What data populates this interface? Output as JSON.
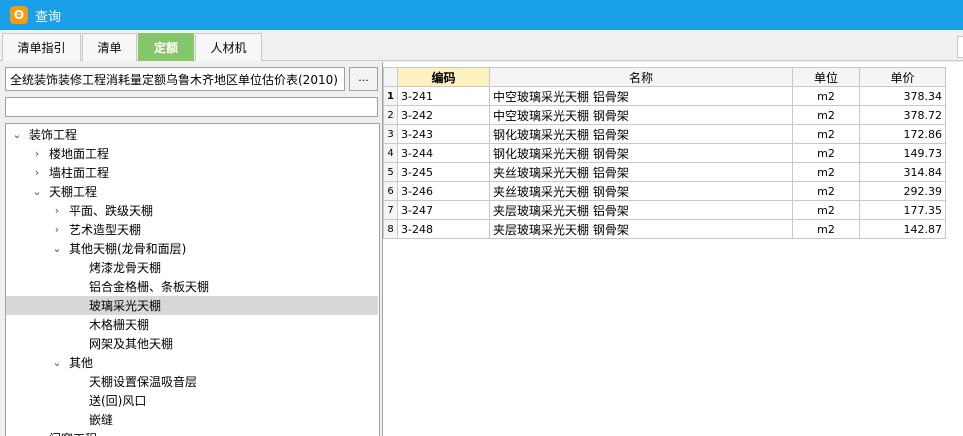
{
  "window": {
    "title": "查询"
  },
  "tabs": [
    {
      "label": "清单指引",
      "active": false
    },
    {
      "label": "清单",
      "active": false
    },
    {
      "label": "定额",
      "active": true
    },
    {
      "label": "人材机",
      "active": false
    }
  ],
  "left": {
    "library": "全统装饰装修工程消耗量定额乌鲁木齐地区单位估价表(2010)",
    "dots_label": "...",
    "search_value": ""
  },
  "tree": [
    {
      "label": "装饰工程",
      "level": 0,
      "state": "expanded",
      "selected": false
    },
    {
      "label": "楼地面工程",
      "level": 1,
      "state": "collapsed",
      "selected": false
    },
    {
      "label": "墙柱面工程",
      "level": 1,
      "state": "collapsed",
      "selected": false
    },
    {
      "label": "天棚工程",
      "level": 1,
      "state": "expanded",
      "selected": false
    },
    {
      "label": "平面、跌级天棚",
      "level": 2,
      "state": "collapsed",
      "selected": false
    },
    {
      "label": "艺术造型天棚",
      "level": 2,
      "state": "collapsed",
      "selected": false
    },
    {
      "label": "其他天棚(龙骨和面层)",
      "level": 2,
      "state": "expanded",
      "selected": false
    },
    {
      "label": "烤漆龙骨天棚",
      "level": 3,
      "state": "leaf",
      "selected": false
    },
    {
      "label": "铝合金格栅、条板天棚",
      "level": 3,
      "state": "leaf",
      "selected": false
    },
    {
      "label": "玻璃采光天棚",
      "level": 3,
      "state": "leaf",
      "selected": true
    },
    {
      "label": "木格栅天棚",
      "level": 3,
      "state": "leaf",
      "selected": false
    },
    {
      "label": "网架及其他天棚",
      "level": 3,
      "state": "leaf",
      "selected": false
    },
    {
      "label": "其他",
      "level": 2,
      "state": "expanded",
      "selected": false
    },
    {
      "label": "天棚设置保温吸音层",
      "level": 3,
      "state": "leaf",
      "selected": false
    },
    {
      "label": "送(回)风口",
      "level": 3,
      "state": "leaf",
      "selected": false
    },
    {
      "label": "嵌缝",
      "level": 3,
      "state": "leaf",
      "selected": false
    },
    {
      "label": "门窗工程",
      "level": 1,
      "state": "collapsed",
      "selected": false
    }
  ],
  "grid": {
    "headers": {
      "code": "编码",
      "name": "名称",
      "unit": "单位",
      "price": "单价"
    },
    "rows": [
      {
        "num": "1",
        "code": "3-241",
        "name": "中空玻璃采光天棚 铝骨架",
        "unit": "m2",
        "price": "378.34"
      },
      {
        "num": "2",
        "code": "3-242",
        "name": "中空玻璃采光天棚 钢骨架",
        "unit": "m2",
        "price": "378.72"
      },
      {
        "num": "3",
        "code": "3-243",
        "name": "钢化玻璃采光天棚 铝骨架",
        "unit": "m2",
        "price": "172.86"
      },
      {
        "num": "4",
        "code": "3-244",
        "name": "钢化玻璃采光天棚 钢骨架",
        "unit": "m2",
        "price": "149.73"
      },
      {
        "num": "5",
        "code": "3-245",
        "name": "夹丝玻璃采光天棚 铝骨架",
        "unit": "m2",
        "price": "314.84"
      },
      {
        "num": "6",
        "code": "3-246",
        "name": "夹丝玻璃采光天棚 钢骨架",
        "unit": "m2",
        "price": "292.39"
      },
      {
        "num": "7",
        "code": "3-247",
        "name": "夹层玻璃采光天棚 铝骨架",
        "unit": "m2",
        "price": "177.35"
      },
      {
        "num": "8",
        "code": "3-248",
        "name": "夹层玻璃采光天棚 钢骨架",
        "unit": "m2",
        "price": "142.87"
      }
    ]
  },
  "colors": {
    "titlebar": "#1aa0e8",
    "active_tab": "#86c66a",
    "header_highlight": "#fdf1c0",
    "selected_node": "#d8d8d8"
  }
}
